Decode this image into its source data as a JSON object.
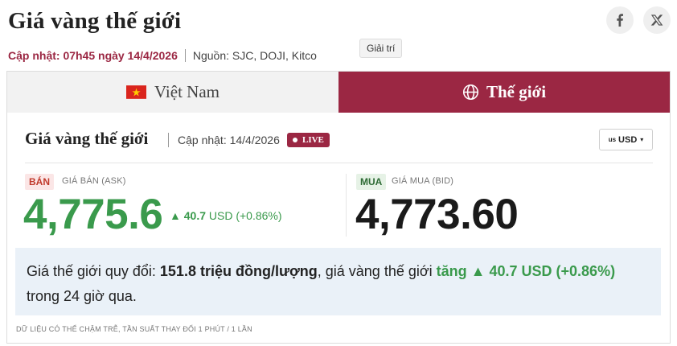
{
  "header": {
    "title": "Giá vàng thế giới",
    "updated": "Cập nhật: 07h45 ngày 14/4/2026",
    "source": "Nguồn: SJC, DOJI, Kitco",
    "tooltip": "Giải trí",
    "share": [
      {
        "icon": "facebook-icon",
        "glyph": "f"
      },
      {
        "icon": "x-icon",
        "glyph": "𝕏"
      }
    ]
  },
  "tabs": [
    {
      "label": "Việt Nam",
      "icon": "vietnam-flag-icon",
      "active": false
    },
    {
      "label": "Thế giới",
      "icon": "globe-icon",
      "active": true
    }
  ],
  "card": {
    "title": "Giá vàng thế giới",
    "updated": "Cập nhật: 14/4/2026",
    "live_label": "LIVE",
    "currency": {
      "flag_text": "us",
      "value": "USD",
      "caret": "▾"
    },
    "sell": {
      "badge": "BÁN",
      "label": "GIÁ BÁN (ASK)",
      "price": "4,775.6",
      "change_arrow": "▲",
      "change_value": "40.7",
      "change_unit": "USD",
      "change_percent": "(+0.86%)"
    },
    "buy": {
      "badge": "MUA",
      "label": "GIÁ MUA (BID)",
      "price": "4,773.60"
    },
    "info": {
      "prefix": "Giá thế giới quy đổi: ",
      "converted": "151.8 triệu đồng/lượng",
      "middle": ", giá vàng thế giới ",
      "trend": "tăng ▲ 40.7 USD (+0.86%)",
      "suffix": " trong 24 giờ qua."
    },
    "note": "DỮ LIỆU CÓ THỂ CHẬM TRỄ, TẦN SUẤT THAY ĐỔI 1 PHÚT / 1 LẦN"
  },
  "colors": {
    "brand": "#9b2743",
    "up": "#3a9a4c",
    "info_bg": "#eaf1f8"
  }
}
